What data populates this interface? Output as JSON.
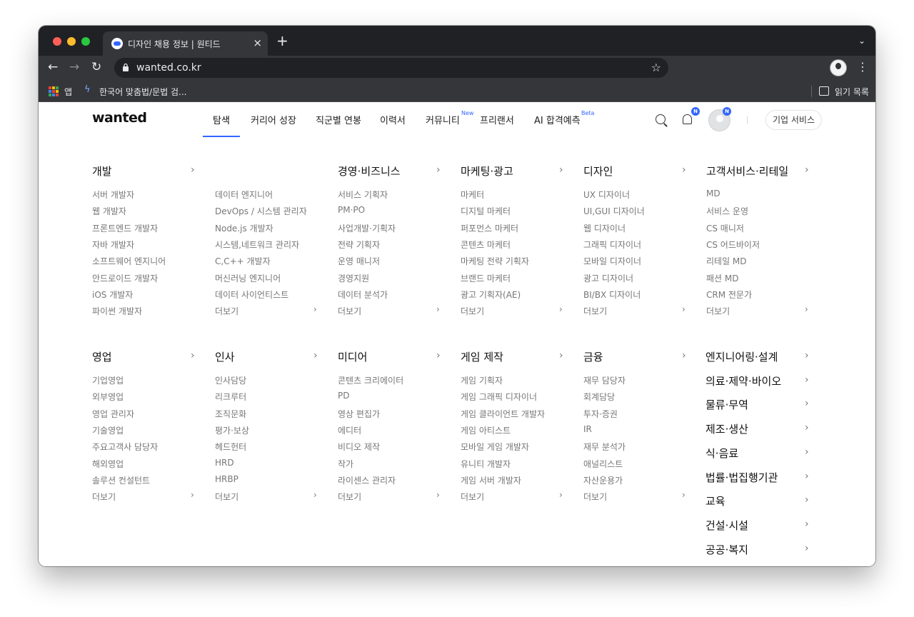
{
  "browser": {
    "tab_title": "디자인 채용 정보 | 원티드",
    "tab_close": "×",
    "new_tab": "+",
    "url": "wanted.co.kr",
    "bookmarks": [
      {
        "label": "앱"
      },
      {
        "label": "한국어 맞춤법/문법 검..."
      }
    ],
    "reading_list": "읽기 목록",
    "traffic_colors": [
      "#ff5f57",
      "#febc2e",
      "#28c840"
    ]
  },
  "site": {
    "logo": "wanted",
    "nav": [
      {
        "label": "탐색"
      },
      {
        "label": "커리어 성장"
      },
      {
        "label": "직군별 연봉"
      },
      {
        "label": "이력서"
      },
      {
        "label": "커뮤니티"
      },
      {
        "label": "프리랜서"
      },
      {
        "label": "AI 합격예측"
      }
    ],
    "nav_sup": {
      "community": "New",
      "ai": "Beta"
    },
    "badge": "N",
    "corp_service": "기업 서비스",
    "accent": "#3366ff"
  },
  "categories_row1": [
    {
      "title": "개발",
      "items": [
        "서버 개발자",
        "웹 개발자",
        "프론트엔드 개발자",
        "자바 개발자",
        "소프트웨어 엔지니어",
        "안드로이드 개발자",
        "iOS 개발자",
        "파이썬 개발자"
      ]
    },
    {
      "title": "",
      "items": [
        "데이터 엔지니어",
        "DevOps / 시스템 관리자",
        "Node.js 개발자",
        "시스템,네트워크 관리자",
        "C,C++ 개발자",
        "머신러닝 엔지니어",
        "데이터 사이언티스트",
        "더보기"
      ]
    },
    {
      "title": "경영·비즈니스",
      "items": [
        "서비스 기획자",
        "PM·PO",
        "사업개발·기획자",
        "전략 기획자",
        "운영 매니저",
        "경영지원",
        "데이터 분석가",
        "더보기"
      ]
    },
    {
      "title": "마케팅·광고",
      "items": [
        "마케터",
        "디지털 마케터",
        "퍼포먼스 마케터",
        "콘텐츠 마케터",
        "마케팅 전략 기획자",
        "브랜드 마케터",
        "광고 기획자(AE)",
        "더보기"
      ]
    },
    {
      "title": "디자인",
      "items": [
        "UX 디자이너",
        "UI,GUI 디자이너",
        "웹 디자이너",
        "그래픽 디자이너",
        "모바일 디자이너",
        "광고 디자이너",
        "BI/BX 디자이너",
        "더보기"
      ]
    },
    {
      "title": "고객서비스·리테일",
      "items": [
        "MD",
        "서비스 운영",
        "CS 매니저",
        "CS 어드바이저",
        "리테일 MD",
        "패션 MD",
        "CRM 전문가",
        "더보기"
      ]
    }
  ],
  "categories_row2": [
    {
      "title": "영업",
      "items": [
        "기업영업",
        "외부영업",
        "영업 관리자",
        "기술영업",
        "주요고객사 담당자",
        "해외영업",
        "솔루션 컨설턴트",
        "더보기"
      ]
    },
    {
      "title": "인사",
      "items": [
        "인사담당",
        "리크루터",
        "조직문화",
        "평가·보상",
        "헤드헌터",
        "HRD",
        "HRBP",
        "더보기"
      ]
    },
    {
      "title": "미디어",
      "items": [
        "콘텐츠 크리에이터",
        "PD",
        "영상 편집가",
        "에디터",
        "비디오 제작",
        "작가",
        "라이센스 관리자",
        "더보기"
      ]
    },
    {
      "title": "게임 제작",
      "items": [
        "게임 기획자",
        "게임 그래픽 디자이너",
        "게임 클라이언트 개발자",
        "게임 아티스트",
        "모바일 게임 개발자",
        "유니티 개발자",
        "게임 서버 개발자",
        "더보기"
      ]
    },
    {
      "title": "금융",
      "items": [
        "재무 담당자",
        "회계담당",
        "투자·증권",
        "IR",
        "재무 분석가",
        "애널리스트",
        "자산운용가",
        "더보기"
      ]
    }
  ],
  "more_categories": [
    "엔지니어링·설계",
    "의료·제약·바이오",
    "물류·무역",
    "제조·생산",
    "식·음료",
    "법률·법집행기관",
    "교육",
    "건설·시설",
    "공공·복지"
  ]
}
